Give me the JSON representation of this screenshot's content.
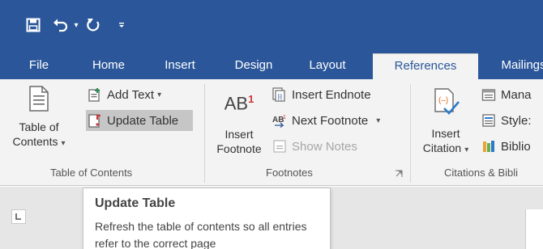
{
  "quick_access": {
    "save_icon": "save-icon",
    "undo_icon": "undo-icon",
    "redo_icon": "redo-icon",
    "customize_icon": "customize-qat-icon"
  },
  "tabs": [
    {
      "label": "File",
      "active": false
    },
    {
      "label": "Home",
      "active": false
    },
    {
      "label": "Insert",
      "active": false
    },
    {
      "label": "Design",
      "active": false
    },
    {
      "label": "Layout",
      "active": false
    },
    {
      "label": "References",
      "active": true
    },
    {
      "label": "Mailings",
      "active": false
    }
  ],
  "colors": {
    "title_bar": "#2b579a",
    "ribbon_bg": "#f3f3f3",
    "highlight": "#c6c6c6",
    "footnote_red": "#d13438"
  },
  "groups": {
    "toc": {
      "label": "Table of Contents",
      "table_of_contents": {
        "line1": "Table of",
        "line2": "Contents"
      },
      "add_text": "Add Text",
      "update_table": "Update Table"
    },
    "footnotes": {
      "label": "Footnotes",
      "insert_footnote": {
        "line1": "Insert",
        "line2": "Footnote",
        "icon_text": "AB",
        "icon_sup": "1"
      },
      "insert_endnote": "Insert Endnote",
      "next_footnote": "Next Footnote",
      "show_notes": "Show Notes"
    },
    "citations": {
      "label": "Citations & Bibli",
      "insert_citation": {
        "line1": "Insert",
        "line2": "Citation"
      },
      "manage": "Mana",
      "style": "Style:",
      "bibliography": "Biblio"
    }
  },
  "tooltip": {
    "title": "Update Table",
    "body": "Refresh the table of contents so all entries refer to the correct page"
  }
}
